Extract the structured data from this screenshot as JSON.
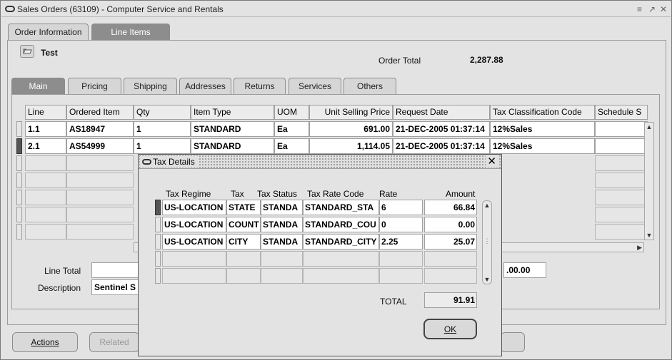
{
  "window": {
    "title": "Sales Orders (63109) - Computer Service and Rentals",
    "controls": "≤ ↗ ✕"
  },
  "top_tabs": [
    {
      "label": "Order Information"
    },
    {
      "label": "Line Items"
    }
  ],
  "header": {
    "customer": "Test",
    "order_total_label": "Order Total",
    "order_total_value": "2,287.88"
  },
  "sub_tabs": [
    "Main",
    "Pricing",
    "Shipping",
    "Addresses",
    "Returns",
    "Services",
    "Others"
  ],
  "lines_table": {
    "columns": [
      "Line",
      "Ordered Item",
      "Qty",
      "Item Type",
      "UOM",
      "Unit Selling Price",
      "Request Date",
      "Tax Classification Code",
      "Schedule S"
    ],
    "rows": [
      [
        "1.1",
        "AS18947",
        "1",
        "STANDARD",
        "Ea",
        "691.00",
        "21-DEC-2005 01:37:14",
        "12%Sales",
        ""
      ],
      [
        "2.1",
        "AS54999",
        "1",
        "STANDARD",
        "Ea",
        "1,114.05",
        "21-DEC-2005 01:37:14",
        "12%Sales",
        ""
      ]
    ]
  },
  "footer_fields": {
    "line_total_label": "Line Total",
    "description_label": "Description",
    "description_value": "Sentinel S",
    "right_amount": ".00.00"
  },
  "buttons": {
    "actions": "Actions",
    "related": "Related"
  },
  "tax_dialog": {
    "title": "Tax Details",
    "columns": [
      "Tax Regime",
      "Tax",
      "Tax Status",
      "Tax Rate Code",
      "Rate",
      "Amount"
    ],
    "rows": [
      [
        "US-LOCATION",
        "STATE",
        "STANDA",
        "STANDARD_STA",
        "6",
        "66.84"
      ],
      [
        "US-LOCATION",
        "COUNT",
        "STANDA",
        "STANDARD_COU",
        "0",
        "0.00"
      ],
      [
        "US-LOCATION",
        "CITY",
        "STANDA",
        "STANDARD_CITY",
        "2.25",
        "25.07"
      ]
    ],
    "total_label": "TOTAL",
    "total_value": "91.91",
    "ok_label": "OK"
  }
}
